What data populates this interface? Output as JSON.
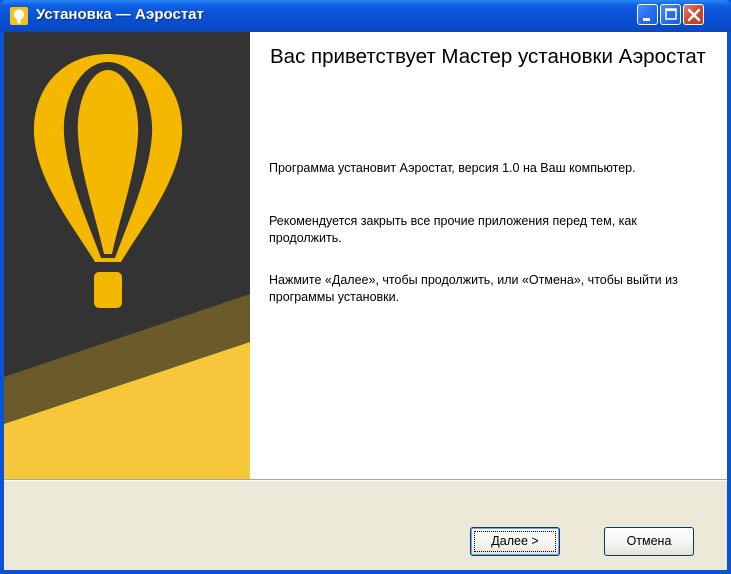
{
  "window": {
    "title": "Установка — Аэростат",
    "controls": {
      "minimize": "minimize-icon",
      "maximize": "maximize-icon",
      "close": "close-icon"
    }
  },
  "banner": {
    "logo": "balloon-logo",
    "colors": {
      "dark": "#333333",
      "brown": "#6b5a2a",
      "yellow": "#f6c63b",
      "gold": "#f5b800"
    }
  },
  "content": {
    "heading": "Вас приветствует Мастер установки Аэростат",
    "paragraph1": "Программа установит Аэростат, версия 1.0 на Ваш компьютер.",
    "paragraph2": "Рекомендуется закрыть все прочие приложения перед тем, как продолжить.",
    "paragraph3": "Нажмите «Далее», чтобы продолжить, или «Отмена», чтобы выйти из программы установки."
  },
  "buttons": {
    "next_label": "Далее >",
    "cancel_label": "Отмена"
  }
}
